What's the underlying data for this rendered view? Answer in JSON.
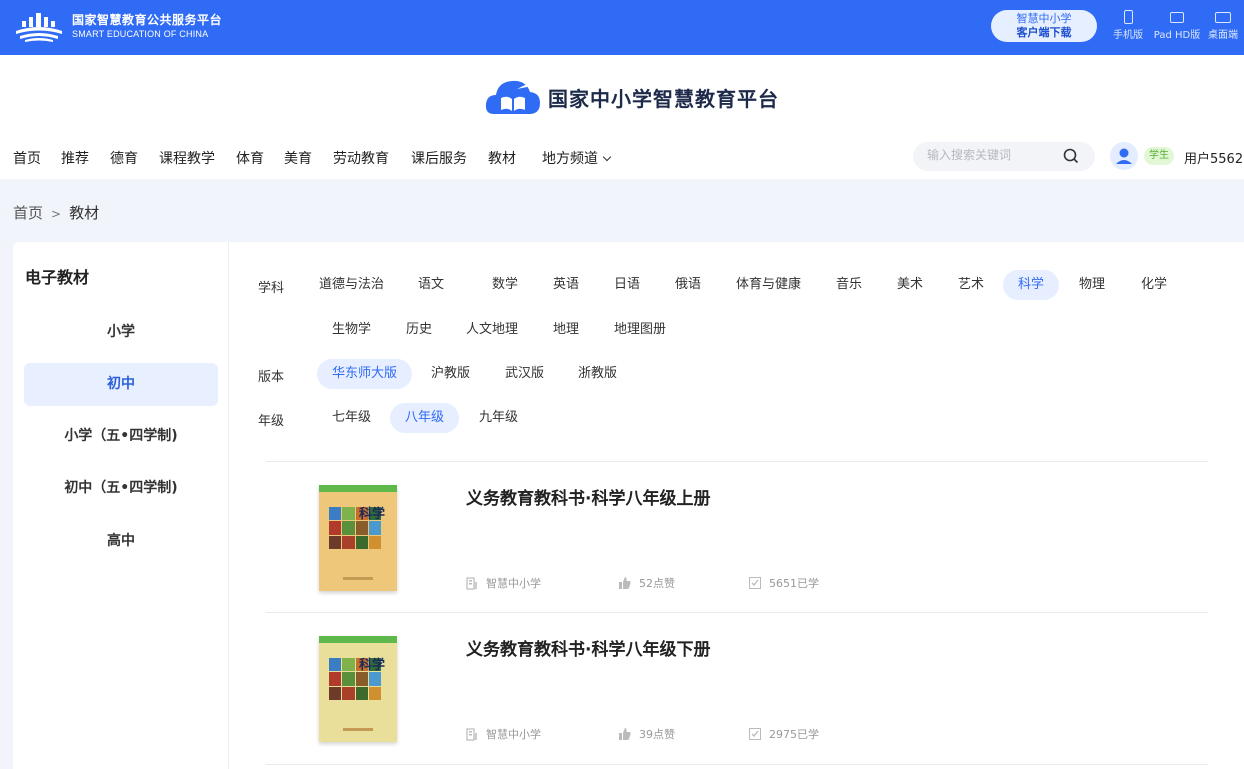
{
  "topbar": {
    "brand_cn": "国家智慧教育公共服务平台",
    "brand_en": "SMART EDUCATION OF CHINA",
    "client_line1": "智慧中小学",
    "client_line2": "客户端下载",
    "devices": [
      "手机版",
      "Pad HD版",
      "桌面端"
    ],
    "bg_color": "#2f6bf4"
  },
  "site": {
    "title": "国家中小学智慧教育平台"
  },
  "nav": {
    "items": [
      "首页",
      "推荐",
      "德育",
      "课程教学",
      "体育",
      "美育",
      "劳动教育",
      "课后服务",
      "教材",
      "地方频道"
    ],
    "search_placeholder": "输入搜索关键词",
    "role": "学生",
    "username": "用户5562"
  },
  "breadcrumb": {
    "home": "首页",
    "sep": ">",
    "current": "教材"
  },
  "sidebar": {
    "title": "电子教材",
    "items": [
      "小学",
      "初中",
      "小学（五•四学制)",
      "初中（五•四学制)",
      "高中"
    ],
    "active_index": 1
  },
  "filters": {
    "subject_label": "学科",
    "subjects_row1": [
      "道德与法治",
      "语文",
      "数学",
      "英语",
      "日语",
      "俄语",
      "体育与健康",
      "音乐",
      "美术",
      "艺术",
      "科学",
      "物理",
      "化学"
    ],
    "subjects_row2": [
      "生物学",
      "历史",
      "人文地理",
      "地理",
      "地理图册"
    ],
    "active_subject": "科学",
    "edition_label": "版本",
    "editions": [
      "华东师大版",
      "沪教版",
      "武汉版",
      "浙教版"
    ],
    "active_edition": "华东师大版",
    "grade_label": "年级",
    "grades": [
      "七年级",
      "八年级",
      "九年级"
    ],
    "active_grade": "八年级"
  },
  "books": [
    {
      "title": "义务教育教科书·科学八年级上册",
      "cover_title": "科学",
      "publisher": "智慧中小学",
      "likes": "52点赞",
      "learned": "5651已学"
    },
    {
      "title": "义务教育教科书·科学八年级下册",
      "cover_title": "科学",
      "publisher": "智慧中小学",
      "likes": "39点赞",
      "learned": "2975已学"
    }
  ]
}
